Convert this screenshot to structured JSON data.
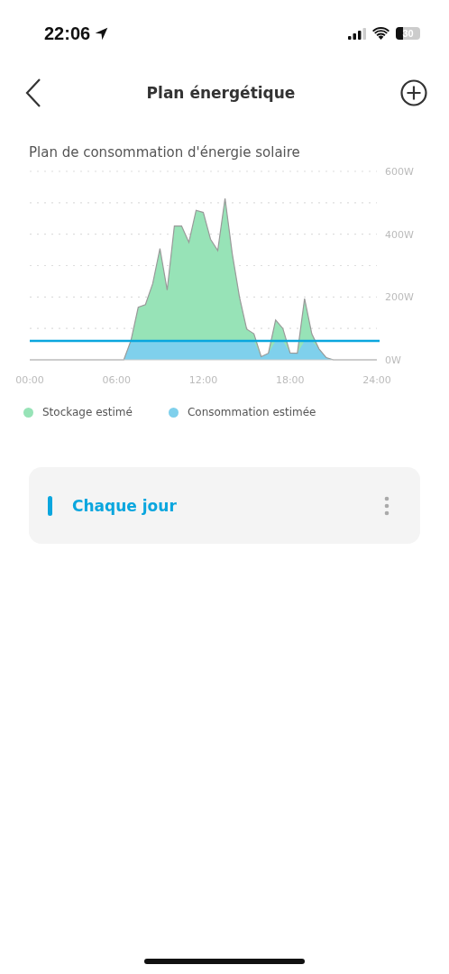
{
  "status_bar": {
    "time": "22:06",
    "battery": "30"
  },
  "header": {
    "title": "Plan énergétique"
  },
  "chart_section": {
    "title": "Plan de consommation d'énergie solaire",
    "chart_data": {
      "type": "area",
      "x": [
        0,
        6.5,
        7,
        7.5,
        8,
        8.5,
        9,
        9.5,
        10,
        10.5,
        11,
        11.5,
        12,
        12.5,
        13,
        13.5,
        14,
        14.5,
        15,
        15.5,
        16,
        16.5,
        17,
        17.5,
        18,
        18.5,
        19,
        19.5,
        20,
        20.5,
        21,
        24
      ],
      "series": [
        {
          "name": "Stockage estimé",
          "color": "#97e3b7",
          "values": [
            0,
            0,
            62,
            167,
            176,
            243,
            354,
            222,
            426,
            426,
            374,
            476,
            469,
            384,
            348,
            514,
            338,
            200,
            98,
            83,
            10,
            21,
            127,
            100,
            22,
            21,
            195,
            83,
            35,
            7,
            0,
            0
          ]
        },
        {
          "name": "Consommation estimée",
          "color": "#7fd0ec",
          "values": [
            0,
            0,
            60,
            60,
            60,
            60,
            60,
            60,
            60,
            60,
            60,
            60,
            60,
            60,
            60,
            60,
            60,
            60,
            60,
            60,
            10,
            21,
            60,
            60,
            22,
            21,
            60,
            60,
            35,
            7,
            0,
            0
          ]
        }
      ],
      "ref_lines": [
        {
          "axis": "y",
          "value": 60,
          "color": "#0aa6de"
        }
      ],
      "xlim": [
        0,
        24
      ],
      "ylim": [
        0,
        600
      ],
      "xticks": [
        {
          "value": 0,
          "label": "00:00"
        },
        {
          "value": 6,
          "label": "06:00"
        },
        {
          "value": 12,
          "label": "12:00"
        },
        {
          "value": 18,
          "label": "18:00"
        },
        {
          "value": 24,
          "label": "24:00"
        }
      ],
      "yticks": [
        {
          "value": 0,
          "label": "0W"
        },
        {
          "value": 200,
          "label": "200W"
        },
        {
          "value": 400,
          "label": "400W"
        },
        {
          "value": 600,
          "label": "600W"
        }
      ]
    }
  },
  "plans": [
    {
      "label": "Chaque jour"
    }
  ]
}
